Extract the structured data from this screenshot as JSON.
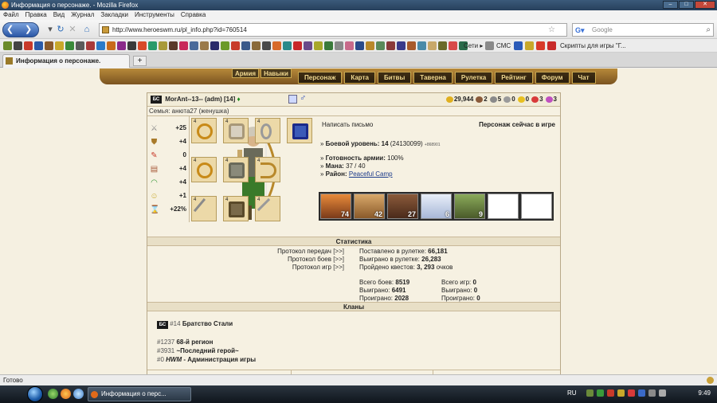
{
  "window": {
    "title": "Информация о персонаже. - Mozilla Firefox"
  },
  "menu": [
    "Файл",
    "Правка",
    "Вид",
    "Журнал",
    "Закладки",
    "Инструменты",
    "Справка"
  ],
  "nav": {
    "url": "http://www.heroeswm.ru/pl_info.php?id=760514",
    "search_placeholder": "Google"
  },
  "bookmarks": {
    "seti": "Сети",
    "sms": "СМС",
    "scripts": "Скрипты для игры \"Г..."
  },
  "tab": {
    "title": "Информация о персонаже.",
    "new_tab": "+"
  },
  "game_nav": {
    "left": [
      "Армия",
      "Навыки"
    ],
    "main": [
      "Персонаж",
      "Карта",
      "Битвы",
      "Таверна",
      "Рулетка",
      "Рейтинг",
      "Форум",
      "Чат"
    ]
  },
  "character": {
    "badge": "БС",
    "name": "MorAnt--13-- (adm)",
    "level": "[14]",
    "family": "Семья: анюта27 (женушка)",
    "resources": [
      {
        "value": "29,944",
        "color": "#e0b020",
        "icon": "gold-icon"
      },
      {
        "value": "2",
        "color": "#8a5a3a",
        "icon": "wood-icon"
      },
      {
        "value": "5",
        "color": "#8a8a8a",
        "icon": "ore-icon"
      },
      {
        "value": "0",
        "color": "#9a9a9a",
        "icon": "mercury-icon"
      },
      {
        "value": "0",
        "color": "#e8c020",
        "icon": "sulfur-icon"
      },
      {
        "value": "3",
        "color": "#d83a3a",
        "icon": "crystal-icon"
      },
      {
        "value": "3",
        "color": "#c050c0",
        "icon": "gem-icon"
      }
    ]
  },
  "stats": [
    {
      "icon": "attack-icon",
      "value": "+25"
    },
    {
      "icon": "defense-icon",
      "value": "+4"
    },
    {
      "icon": "magic-icon",
      "value": "0"
    },
    {
      "icon": "knowledge-icon",
      "value": "+4"
    },
    {
      "icon": "luck-icon",
      "value": "+4"
    },
    {
      "icon": "morale-icon",
      "value": "+1"
    },
    {
      "icon": "initiative-icon",
      "value": "+22%"
    }
  ],
  "equip_levels": [
    "4",
    "4",
    "4",
    "4",
    "4",
    "4",
    "4",
    "4",
    "4"
  ],
  "info": {
    "write": "Написать письмо",
    "online": "Персонаж сейчас в игре",
    "combat_label": "Боевой уровень:",
    "combat_value": "14",
    "combat_exp": "(24130099)",
    "combat_extra": "+868901",
    "army_label": "Готовность армии:",
    "army_value": "100%",
    "mana_label": "Мана:",
    "mana_value": "37 / 40",
    "district_label": "Район:",
    "district_value": "Peaceful Camp"
  },
  "army": [
    "74",
    "42",
    "27",
    "6",
    "9",
    "",
    ""
  ],
  "statistics": {
    "title": "Статистика",
    "protocols": [
      {
        "label": "Протокол передач",
        "link": "[>>]"
      },
      {
        "label": "Протокол боев",
        "link": "[>>]"
      },
      {
        "label": "Протокол игр",
        "link": "[>>]"
      }
    ],
    "roulette_bet_label": "Поставлено в рулетке:",
    "roulette_bet": "66,181",
    "roulette_won_label": "Выиграно в рулетке:",
    "roulette_won": "26,283",
    "quests_label": "Пройдено квестов:",
    "quests": "3, 293",
    "quests_unit": "очков",
    "battles_total_label": "Всего боев:",
    "battles_total": "8519",
    "battles_won_label": "Выиграно:",
    "battles_won": "6491",
    "battles_lost_label": "Проиграно:",
    "battles_lost": "2028",
    "games_total_label": "Всего игр:",
    "games_total": "0",
    "games_won_label": "Выиграно:",
    "games_won": "0",
    "games_lost_label": "Проиграно:",
    "games_lost": "0"
  },
  "clans": {
    "title": "Кланы",
    "main": {
      "badge": "БС",
      "num": "#14",
      "name": "Братство Стали"
    },
    "list": [
      {
        "num": "#1237",
        "name": "68-й регион"
      },
      {
        "num": "#3931",
        "name": "~Последний герой~"
      },
      {
        "num": "#0",
        "name_italic": "HWM",
        "name": "- Администрация игры"
      }
    ]
  },
  "status": "Готово",
  "taskbar": {
    "task": "Информация о перс...",
    "lang": "RU",
    "clock": "9:49"
  }
}
